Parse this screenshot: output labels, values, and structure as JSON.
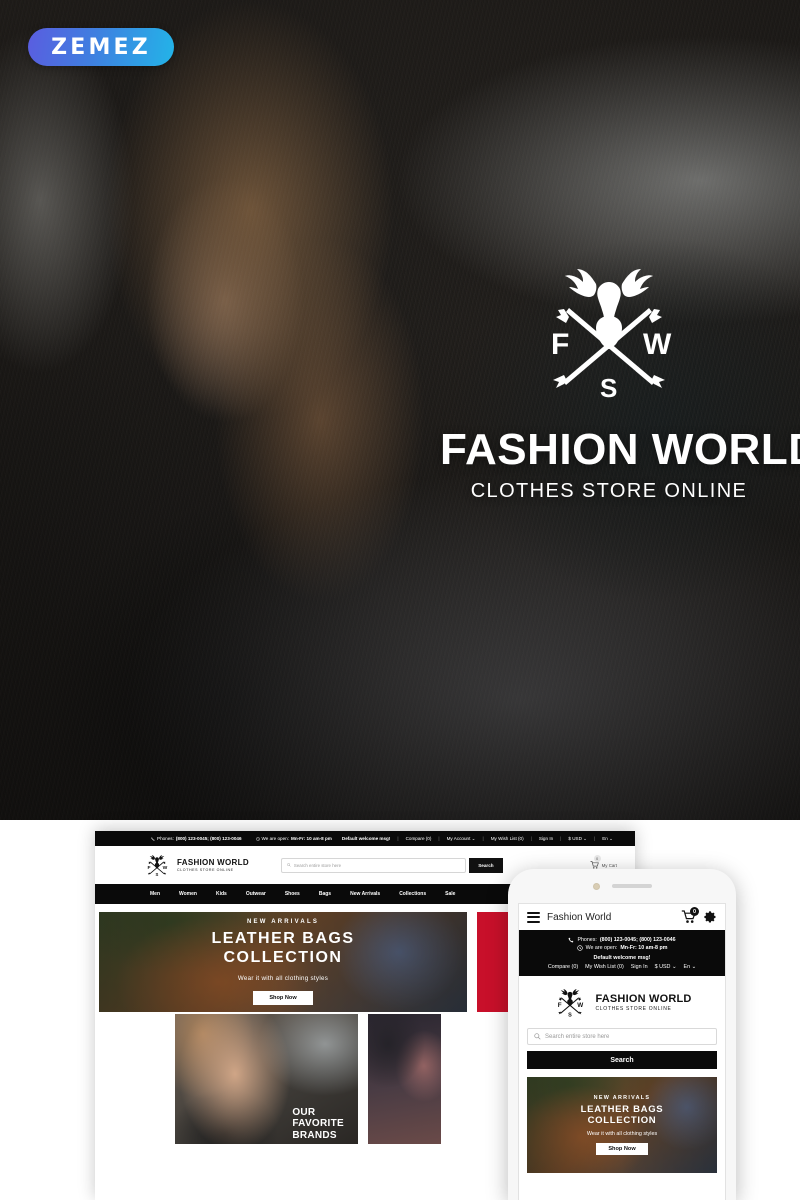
{
  "watermark": {
    "label": "ZEMEZ",
    "gradient_from": "#5a5de0",
    "gradient_to": "#23b4e8"
  },
  "hero": {
    "brand_title": "FASHION WORLD",
    "brand_subtitle": "CLOTHES STORE ONLINE",
    "emblem": {
      "letter_left": "F",
      "letter_right": "W",
      "letter_bottom": "S",
      "icon": "deer-head-crossed-arrows-icon"
    }
  },
  "desktop": {
    "topbar": {
      "phones_label": "Phones:",
      "phones_value": "(800) 123-0045; (800) 123-0046",
      "hours_label": "We are open:",
      "hours_value": "Mn-Fr: 10 am-8 pm",
      "welcome": "Default welcome msg!",
      "links": [
        "Compare (0)",
        "My Account",
        "My Wish List (0)",
        "Sign In",
        "$ USD",
        "En"
      ]
    },
    "header": {
      "logo_title": "FASHION WORLD",
      "logo_subtitle": "CLOTHES STORE ONLINE",
      "search_placeholder": "Search entire store here",
      "search_button": "Search",
      "cart_label": "My Cart",
      "cart_count": "0"
    },
    "nav": [
      "Men",
      "Women",
      "Kids",
      "Outwear",
      "Shoes",
      "Bags",
      "New Arrivals",
      "Collections",
      "Sale"
    ],
    "banner": {
      "kicker": "NEW ARRIVALS",
      "title_line1": "LEATHER BAGS",
      "title_line2": "COLLECTION",
      "subtitle": "Wear it with all clothing styles",
      "button": "Shop Now"
    },
    "red_panel_color": "#c8102a",
    "tiles": {
      "favorite_brands": "OUR\nFAVORITE\nBRANDS"
    }
  },
  "mobile": {
    "header": {
      "title": "Fashion World",
      "cart_count": "0"
    },
    "topbar": {
      "phones_label": "Phones:",
      "phones_value": "(800) 123-0045; (800) 123-0046",
      "hours_label": "We are open:",
      "hours_value": "Mn-Fr: 10 am-8 pm",
      "welcome": "Default welcome msg!",
      "links": [
        "Compare (0)",
        "My Wish List (0)",
        "Sign In",
        "$ USD",
        "En"
      ]
    },
    "logo_title": "FASHION WORLD",
    "logo_subtitle": "CLOTHES STORE ONLINE",
    "search_placeholder": "Search entire store here",
    "search_button": "Search",
    "banner": {
      "kicker": "NEW ARRIVALS",
      "title_line1": "LEATHER BAGS",
      "title_line2": "COLLECTION",
      "subtitle": "Wear it with all clothing styles",
      "button": "Shop Now"
    }
  }
}
